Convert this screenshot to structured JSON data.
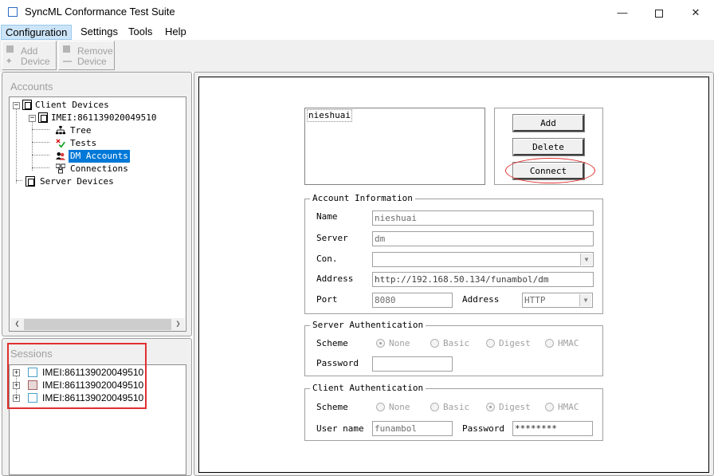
{
  "window": {
    "title": "SyncML Conformance Test Suite"
  },
  "menu": {
    "configuration": "Configuration",
    "settings": "Settings",
    "tools": "Tools",
    "help": "Help"
  },
  "toolbar": {
    "add_line1": "Add",
    "add_line2": "Device",
    "remove_line1": "Remove",
    "remove_line2": "Device"
  },
  "accounts_panel": {
    "title": "Accounts",
    "tree": {
      "client_devices": "Client Devices",
      "device_imei": "IMEI:861139020049510",
      "tree": "Tree",
      "tests": "Tests",
      "dm_accounts": "DM Accounts",
      "connections": "Connections",
      "server_devices": "Server Devices"
    }
  },
  "sessions_panel": {
    "title": "Sessions",
    "items": [
      "IMEI:861139020049510",
      "IMEI:861139020049510",
      "IMEI:861139020049510"
    ]
  },
  "accounts_form": {
    "account_list": [
      "nieshuai"
    ],
    "buttons": {
      "add": "Add",
      "delete": "Delete",
      "connect": "Connect"
    },
    "account_information": {
      "title": "Account Information",
      "name_label": "Name",
      "name_value": "nieshuai",
      "server_label": "Server",
      "server_value": "dm",
      "con_label": "Con.",
      "con_value": "",
      "address_label": "Address",
      "address_value": "http://192.168.50.134/funambol/dm",
      "port_label": "Port",
      "port_value": "8080",
      "address_type_label": "Address",
      "address_type_value": "HTTP"
    },
    "server_authentication": {
      "title": "Server Authentication",
      "scheme_label": "Scheme",
      "schemes": [
        "None",
        "Basic",
        "Digest",
        "HMAC"
      ],
      "selected": "None",
      "password_label": "Password",
      "password_value": ""
    },
    "client_authentication": {
      "title": "Client Authentication",
      "scheme_label": "Scheme",
      "schemes": [
        "None",
        "Basic",
        "Digest",
        "HMAC"
      ],
      "selected": "Digest",
      "username_label": "User name",
      "username_value": "funambol",
      "password_label": "Password",
      "password_value": "********"
    }
  },
  "colors": {
    "selection": "#0078d7",
    "highlight": "#e03030",
    "menu_active": "#cce4f7"
  }
}
